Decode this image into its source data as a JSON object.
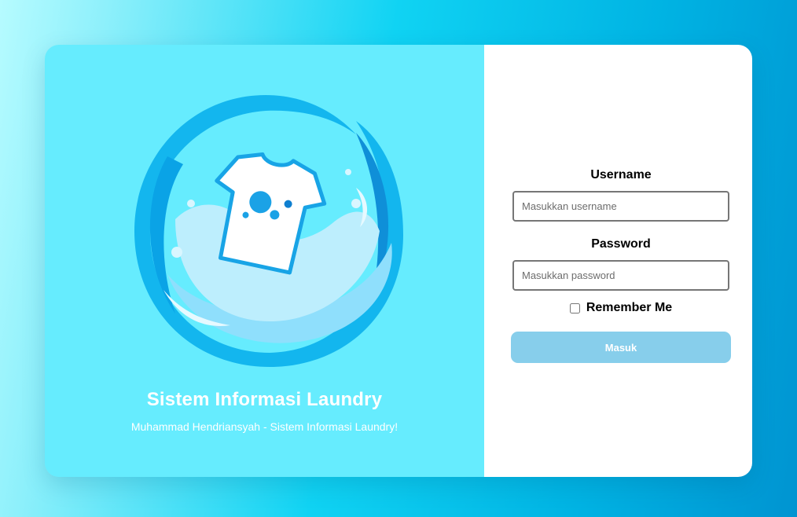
{
  "brand": {
    "title": "Sistem Informasi Laundry",
    "subtitle": "Muhammad Hendriansyah - Sistem Informasi Laundry!",
    "illustration": "laundry-splash-shirt-illustration"
  },
  "login_form": {
    "username_label": "Username",
    "username_placeholder": "Masukkan username",
    "username_value": "",
    "password_label": "Password",
    "password_placeholder": "Masukkan password",
    "password_value": "",
    "remember_label": "Remember Me",
    "remember_checked": false,
    "submit_label": "Masuk"
  },
  "colors": {
    "left_panel": "#66ecfe",
    "submit_button": "#87ceeb",
    "background_gradient_start": "#b6fbff",
    "background_gradient_end": "#0094d1"
  }
}
